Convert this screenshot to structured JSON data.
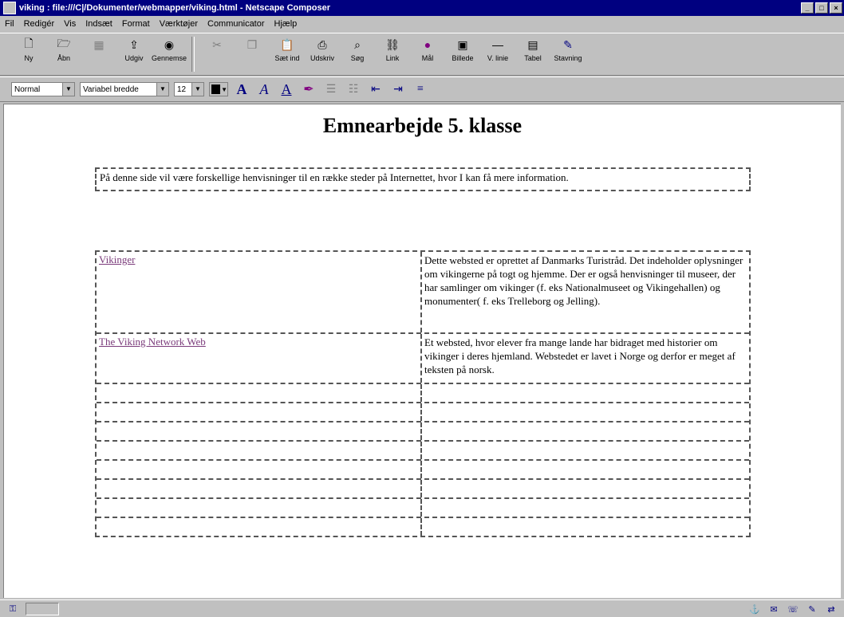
{
  "window": {
    "title": "viking : file:///C|/Dokumenter/webmapper/viking.html - Netscape Composer",
    "controls": {
      "minimize": "_",
      "maximize": "□",
      "close": "×"
    }
  },
  "menu": [
    {
      "label": "Fil"
    },
    {
      "label": "Redigér"
    },
    {
      "label": "Vis"
    },
    {
      "label": "Indsæt"
    },
    {
      "label": "Format"
    },
    {
      "label": "Værktøjer"
    },
    {
      "label": "Communicator"
    },
    {
      "label": "Hjælp"
    }
  ],
  "toolbar": {
    "new": "Ny",
    "open": "Åbn",
    "save_disabled": "",
    "publish": "Udgiv",
    "preview": "Gennemse",
    "cut": "",
    "copy": "",
    "paste": "",
    "print": "Sæt ind",
    "find": "Udskriv",
    "search": "Søg",
    "link": "Link",
    "target": "Mål",
    "image": "Billede",
    "hline": "V. linie",
    "table": "Tabel",
    "spelling": "Stavning"
  },
  "formatbar": {
    "style": "Normal",
    "font": "Variabel bredde",
    "size": "12",
    "swatch_color": "#000000"
  },
  "document": {
    "heading": "Emnearbejde 5. klasse",
    "intro": "På denne side vil være forskellige henvisninger til en række steder på Internettet, hvor I kan få mere information.",
    "rows": [
      {
        "link": "Vikinger",
        "desc": "Dette websted er oprettet af Danmarks Turistråd. Det indeholder oplysninger om vikingerne på togt og hjemme. Der er også henvisninger til museer, der har samlinger om vikinger (f. eks Nationalmuseet og Vikingehallen) og monumenter( f. eks Trelleborg og Jelling)."
      },
      {
        "link": "The Viking Network Web",
        "desc": "Et websted, hvor elever fra mange lande har bidraget med historier om vikinger i deres hjemland. Webstedet er lavet i Norge og derfor er meget af teksten på norsk."
      },
      {
        "link": "",
        "desc": ""
      },
      {
        "link": "",
        "desc": ""
      },
      {
        "link": "",
        "desc": ""
      },
      {
        "link": "",
        "desc": ""
      },
      {
        "link": "",
        "desc": ""
      },
      {
        "link": "",
        "desc": ""
      },
      {
        "link": "",
        "desc": ""
      },
      {
        "link": "",
        "desc": ""
      }
    ]
  }
}
